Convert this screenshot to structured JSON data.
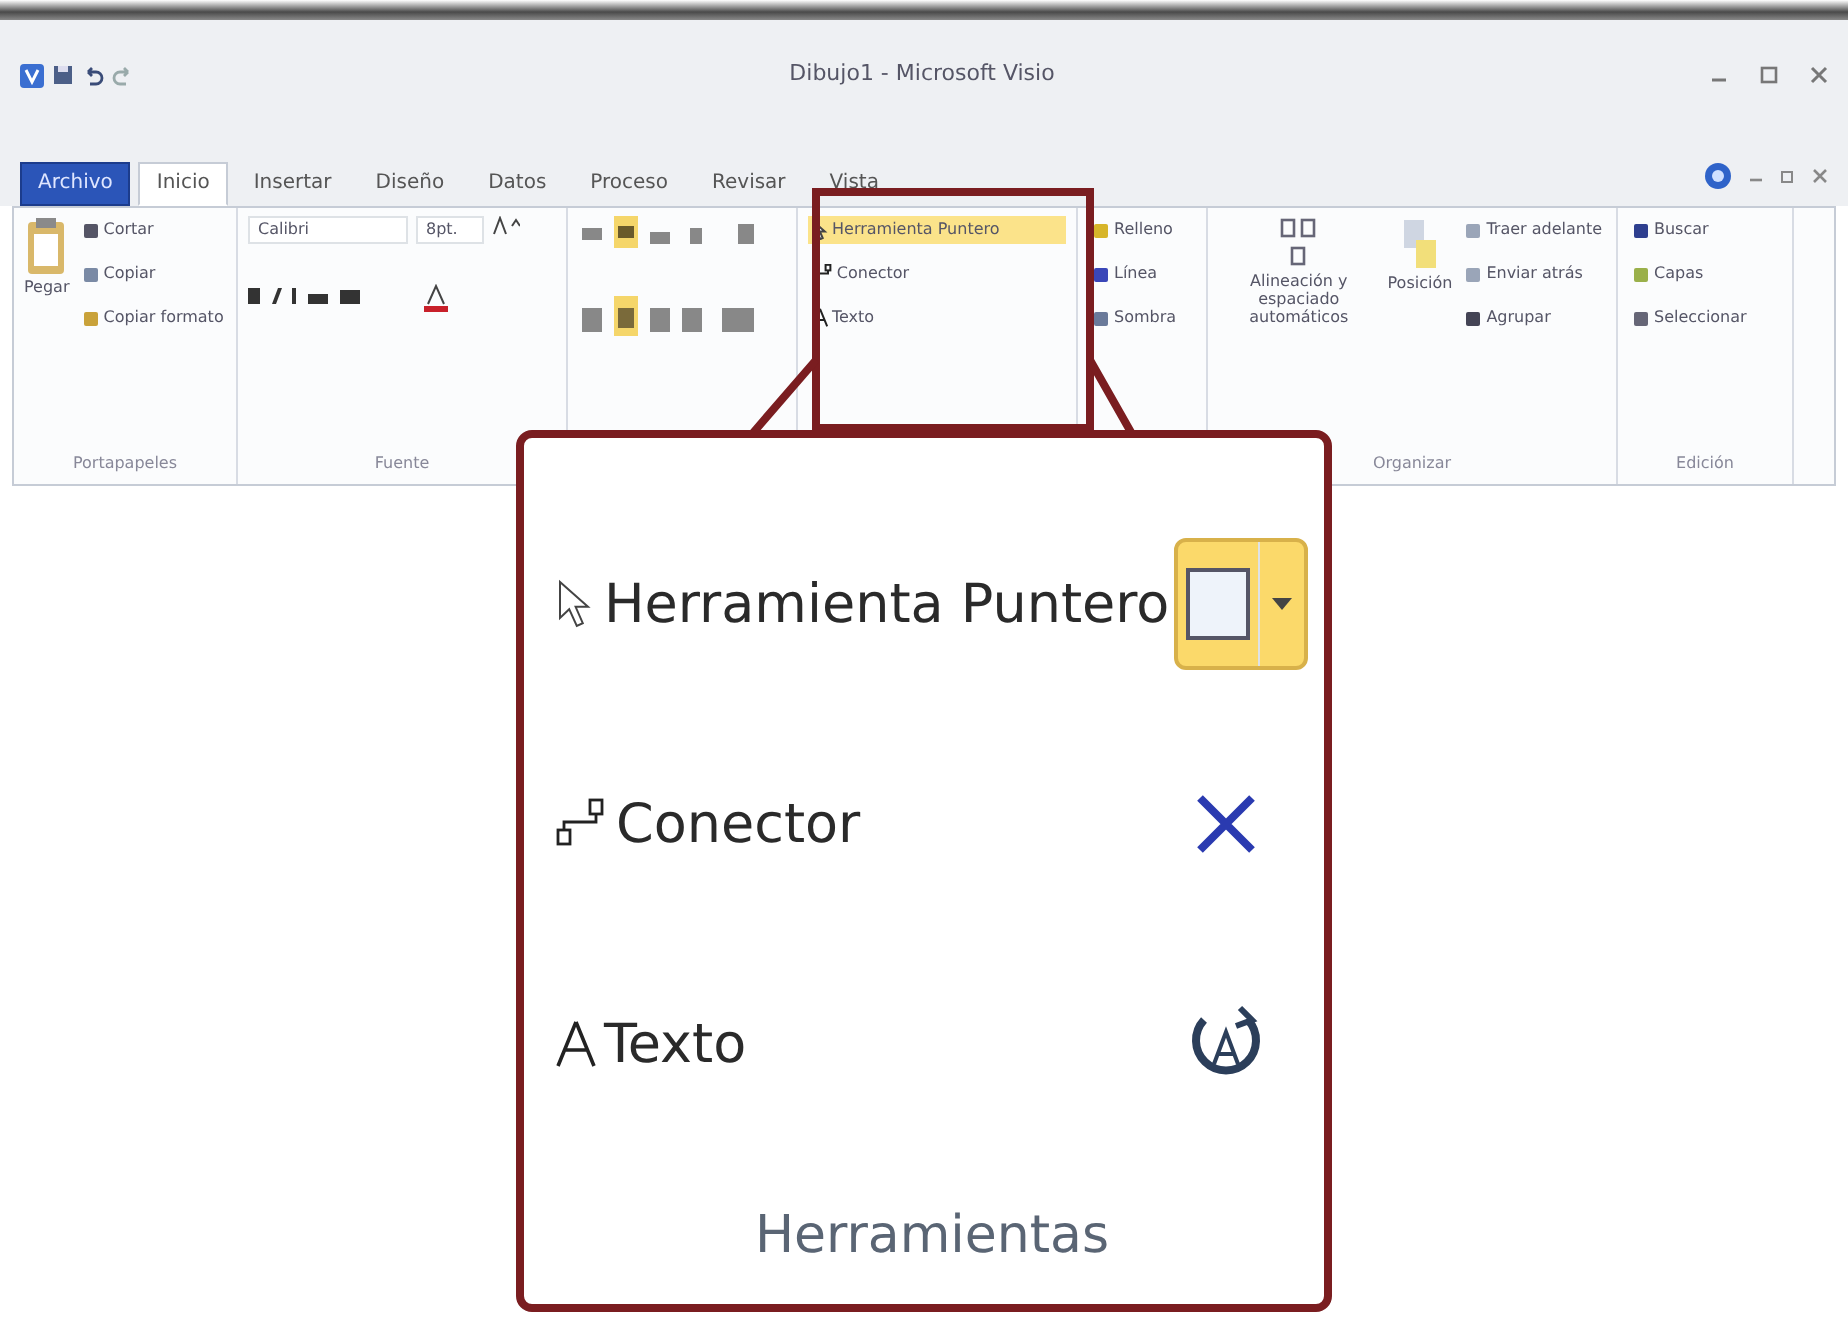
{
  "window": {
    "title": "Dibujo1 - Microsoft Visio"
  },
  "tabs": [
    {
      "label": "Archivo",
      "kind": "file",
      "selected": false
    },
    {
      "label": "Inicio",
      "kind": "tab",
      "selected": true
    },
    {
      "label": "Insertar",
      "kind": "tab",
      "selected": false
    },
    {
      "label": "Diseño",
      "kind": "tab",
      "selected": false
    },
    {
      "label": "Datos",
      "kind": "tab",
      "selected": false
    },
    {
      "label": "Proceso",
      "kind": "tab",
      "selected": false
    },
    {
      "label": "Revisar",
      "kind": "tab",
      "selected": false
    },
    {
      "label": "Vista",
      "kind": "tab",
      "selected": false
    }
  ],
  "ribbon": {
    "clipboard": {
      "label": "Portapapeles",
      "paste": "Pegar",
      "items": [
        "Cortar",
        "Copiar",
        "Copiar formato"
      ]
    },
    "font": {
      "label": "Fuente",
      "name": "Calibri",
      "size": "8pt."
    },
    "tools": [
      {
        "label": "Herramienta Puntero",
        "kind": "pointer",
        "selected": true
      },
      {
        "label": "Conector",
        "kind": "connector",
        "selected": false
      },
      {
        "label": "Texto",
        "kind": "text",
        "selected": false
      }
    ],
    "shape_style": [
      "Relleno",
      "Línea",
      "Sombra"
    ],
    "arrange": {
      "label": "Organizar",
      "auto": "Alineación y espaciado automáticos",
      "position": "Posición",
      "items": [
        "Traer adelante",
        "Enviar atrás",
        "Agrupar"
      ]
    },
    "editing": {
      "label": "Edición",
      "items": [
        "Buscar",
        "Capas",
        "Seleccionar"
      ]
    }
  },
  "callout": {
    "tools": [
      {
        "label": "Herramienta Puntero",
        "kind": "pointer"
      },
      {
        "label": "Conector",
        "kind": "connector"
      },
      {
        "label": "Texto",
        "kind": "text"
      }
    ],
    "shape_button": {
      "selected": true
    },
    "group_label": "Herramientas"
  }
}
